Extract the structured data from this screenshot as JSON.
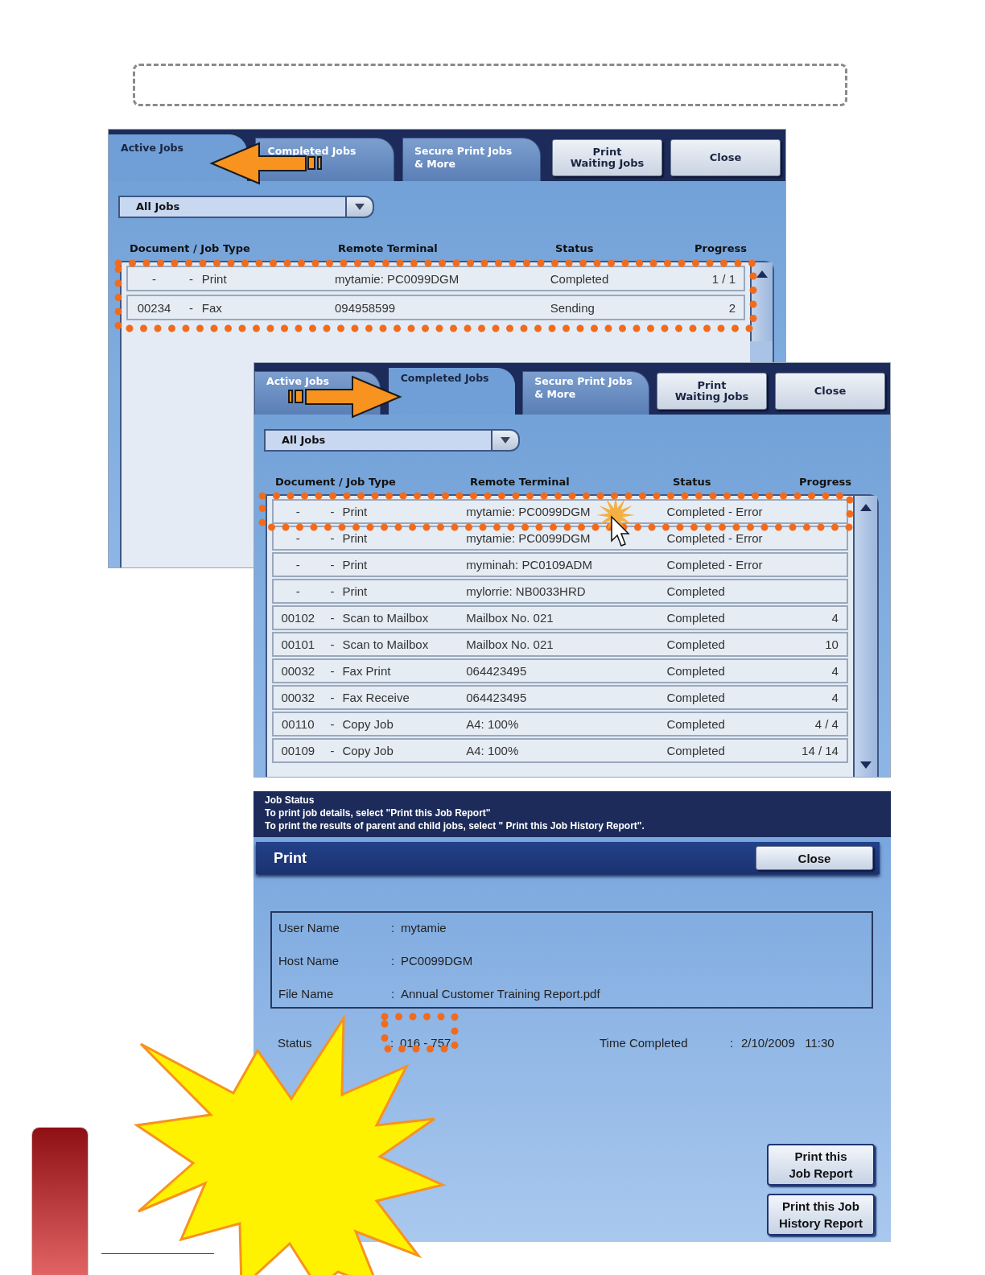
{
  "job_screens": [
    {
      "tabs": [
        {
          "label": "Active Jobs",
          "selected": true
        },
        {
          "label": "Completed Jobs",
          "selected": false
        },
        {
          "label": "Secure Print Jobs\n& More",
          "selected": false
        }
      ],
      "buttons": [
        "Print\nWaiting Jobs",
        "Close"
      ],
      "filter": "All Jobs",
      "columns": [
        "Document / Job Type",
        "Remote Terminal",
        "Status",
        "Progress"
      ],
      "rows": [
        {
          "document": "-",
          "sep": "-",
          "job_type": "Print",
          "remote_terminal": "mytamie: PC0099DGM",
          "status": "Completed",
          "progress": "1 / 1"
        },
        {
          "document": "00234",
          "sep": "-",
          "job_type": "Fax",
          "remote_terminal": "094958599",
          "status": "Sending",
          "progress": "2"
        }
      ]
    },
    {
      "tabs": [
        {
          "label": "Active Jobs",
          "selected": false
        },
        {
          "label": "Completed Jobs",
          "selected": true
        },
        {
          "label": "Secure Print Jobs\n& More",
          "selected": false
        }
      ],
      "buttons": [
        "Print\nWaiting Jobs",
        "Close"
      ],
      "filter": "All Jobs",
      "columns": [
        "Document / Job Type",
        "Remote Terminal",
        "Status",
        "Progress"
      ],
      "rows": [
        {
          "document": "-",
          "sep": "-",
          "job_type": "Print",
          "remote_terminal": "mytamie: PC0099DGM",
          "status": "Completed - Error"
        },
        {
          "document": "-",
          "sep": "-",
          "job_type": "Print",
          "remote_terminal": "mytamie: PC0099DGM",
          "status": "Completed - Error"
        },
        {
          "document": "-",
          "sep": "-",
          "job_type": "Print",
          "remote_terminal": "myminah: PC0109ADM",
          "status": "Completed - Error"
        },
        {
          "document": "-",
          "sep": "-",
          "job_type": "Print",
          "remote_terminal": "mylorrie: NB0033HRD",
          "status": "Completed"
        },
        {
          "document": "00102",
          "sep": "-",
          "job_type": "Scan to Mailbox",
          "remote_terminal": "Mailbox No. 021",
          "status": "Completed",
          "progress": "4"
        },
        {
          "document": "00101",
          "sep": "-",
          "job_type": "Scan to Mailbox",
          "remote_terminal": "Mailbox No. 021",
          "status": "Completed",
          "progress": "10"
        },
        {
          "document": "00032",
          "sep": "-",
          "job_type": "Fax Print",
          "remote_terminal": "064423495",
          "status": "Completed",
          "progress": "4"
        },
        {
          "document": "00032",
          "sep": "-",
          "job_type": "Fax Receive",
          "remote_terminal": "064423495",
          "status": "Completed",
          "progress": "4"
        },
        {
          "document": "00110",
          "sep": "-",
          "job_type": "Copy Job",
          "remote_terminal": "A4: 100%",
          "status": "Completed",
          "progress": "4 / 4"
        },
        {
          "document": "00109",
          "sep": "-",
          "job_type": "Copy Job",
          "remote_terminal": "A4: 100%",
          "status": "Completed",
          "progress": "14 / 14"
        }
      ]
    }
  ],
  "job_status": {
    "title": "Job Status",
    "instructions": [
      "To print job details, select \"Print this Job Report\"",
      "To print the results of parent and child jobs, select \" Print this Job History Report\"."
    ],
    "job_type": "Print",
    "close": "Close",
    "details": [
      {
        "label": "User Name",
        "sep": ":",
        "value": "mytamie"
      },
      {
        "label": "Host Name",
        "sep": ":",
        "value": "PC0099DGM"
      },
      {
        "label": "File Name",
        "sep": ":",
        "value": "Annual Customer Training Report.pdf"
      }
    ],
    "status": {
      "label": "Status",
      "sep": ":",
      "value": "016 - 757"
    },
    "time_completed": {
      "label": "Time Completed",
      "sep": ":",
      "value": "2/10/2009   11:30"
    },
    "buttons": [
      "Print this\nJob Report",
      "Print this Job\nHistory Report"
    ]
  }
}
